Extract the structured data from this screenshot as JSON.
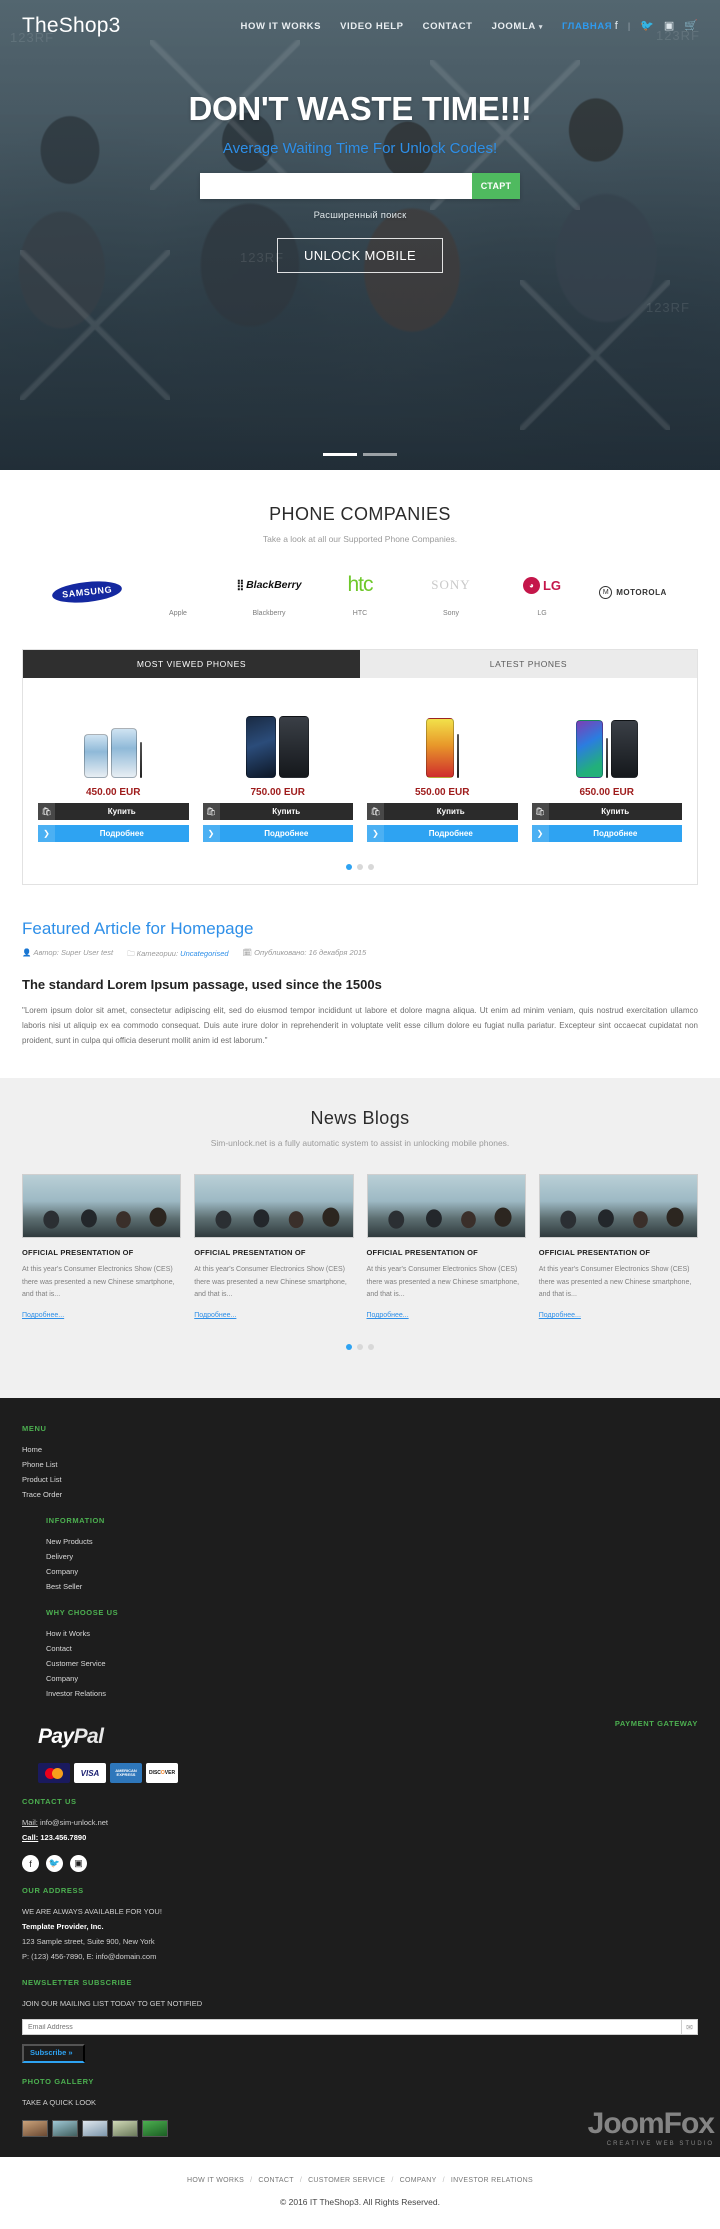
{
  "header": {
    "brand": "TheShop3",
    "nav": [
      {
        "label": "HOW IT WORKS",
        "active": false
      },
      {
        "label": "VIDEO HELP",
        "active": false
      },
      {
        "label": "CONTACT",
        "active": false
      },
      {
        "label": "JOOMLA",
        "active": false,
        "caret": "▾"
      },
      {
        "label": "ГЛАВНАЯ",
        "active": true
      }
    ],
    "social": [
      "f",
      "|",
      "twitter",
      "instagram",
      "cart"
    ]
  },
  "hero": {
    "title": "DON'T WASTE TIME!!!",
    "subtitle": "Average Waiting Time For Unlock Codes!",
    "search_placeholder": "",
    "search_value": "",
    "search_button": "СТАРТ",
    "advanced_search": "Расширенный поиск",
    "cta": "UNLOCK MOBILE",
    "slides": 3,
    "active_slide": 1
  },
  "companies": {
    "title": "PHONE COMPANIES",
    "subtitle": "Take a look at all our Supported Phone Companies.",
    "items": [
      {
        "name": "SAMSUNG",
        "caption": ""
      },
      {
        "name": "Apple",
        "caption": "Apple"
      },
      {
        "name": "BlackBerry",
        "caption": "Blackberry"
      },
      {
        "name": "htc",
        "caption": "HTC"
      },
      {
        "name": "SONY",
        "caption": "Sony"
      },
      {
        "name": "LG",
        "caption": "LG"
      },
      {
        "name": "MOTOROLA",
        "caption": ""
      }
    ]
  },
  "products": {
    "tabs": [
      {
        "label": "MOST VIEWED PHONES",
        "active": true
      },
      {
        "label": "LATEST PHONES",
        "active": false
      }
    ],
    "buy_label": "Купить",
    "more_label": "Подробнее",
    "cards": [
      {
        "price": "450.00 EUR"
      },
      {
        "price": "750.00 EUR"
      },
      {
        "price": "550.00 EUR"
      },
      {
        "price": "650.00 EUR"
      }
    ],
    "dots": 3,
    "active_dot": 1
  },
  "article": {
    "link_title": "Featured Article for Homepage",
    "author_label": "Автор:",
    "author": "Super User test",
    "category_label": "Категории:",
    "category": "Uncategorised",
    "published_label": "Опубликовано:",
    "published": "16 декабря 2015",
    "heading": "The standard Lorem Ipsum passage, used since the 1500s",
    "body": "\"Lorem ipsum dolor sit amet, consectetur adipiscing elit, sed do eiusmod tempor incididunt ut labore et dolore magna aliqua. Ut enim ad minim veniam, quis nostrud exercitation ullamco laboris nisi ut aliquip ex ea commodo consequat. Duis aute irure dolor in reprehenderit in voluptate velit esse cillum dolore eu fugiat nulla pariatur. Excepteur sint occaecat cupidatat non proident, sunt in culpa qui officia deserunt mollit anim id est laborum.\""
  },
  "news": {
    "title": "News Blogs",
    "subtitle": "Sim-unlock.net is a fully automatic system to assist in unlocking mobile phones.",
    "more_label": "Подробнее...",
    "cards": [
      {
        "title": "OFFICIAL PRESENTATION OF",
        "text": "At this year's Consumer Electronics Show (CES) there was presented a new Chinese smartphone, and that is..."
      },
      {
        "title": "OFFICIAL PRESENTATION OF",
        "text": "At this year's Consumer Electronics Show (CES) there was presented a new Chinese smartphone, and that is..."
      },
      {
        "title": "OFFICIAL PRESENTATION OF",
        "text": "At this year's Consumer Electronics Show (CES) there was presented a new Chinese smartphone, and that is..."
      },
      {
        "title": "OFFICIAL PRESENTATION OF",
        "text": "At this year's Consumer Electronics Show (CES) there was presented a new Chinese smartphone, and that is..."
      }
    ],
    "dots": 3,
    "active_dot": 1
  },
  "footer": {
    "menu_head": "MENU",
    "menu": [
      "Home",
      "Phone List",
      "Product List",
      "Trace Order"
    ],
    "information_head": "INFORMATION",
    "information": [
      "New Products",
      "Delivery",
      "Company",
      "Best Seller"
    ],
    "why_head": "WHY CHOOSE US",
    "why": [
      "How it Works",
      "Contact",
      "Customer Service",
      "Company",
      "Investor Relations"
    ],
    "payment_head": "PAYMENT GATEWAY",
    "paypal": "PayPal",
    "cards": [
      "MasterCard",
      "VISA",
      "AMERICAN EXPRESS",
      "DISCOVER"
    ],
    "contact_head": "CONTACT US",
    "mail_label": "Mail:",
    "mail": "info@sim-unlock.net",
    "call_label": "Call:",
    "call": "123.456.7890",
    "address_head": "OUR ADDRESS",
    "address_tagline": "WE ARE ALWAYS AVAILABLE FOR YOU!",
    "company": "Template Provider, Inc.",
    "street": "123 Sample street, Suite 900, New York",
    "phone_email": "P: (123) 456-7890, E: info@domain.com",
    "newsletter_head": "NEWSLETTER SUBSCRIBE",
    "newsletter_tagline": "JOIN OUR MAILING LIST TODAY TO GET NOTIFIED",
    "email_placeholder": "Email Address",
    "subscribe": "Subscribe »",
    "gallery_head": "PHOTO GALLERY",
    "gallery_tagline": "TAKE A QUICK LOOK",
    "watermark_big": "JoomFox",
    "watermark_small": "CREATIVE WEB STUDIO"
  },
  "bottom": {
    "links": [
      "HOW IT WORKS",
      "CONTACT",
      "CUSTOMER SERVICE",
      "COMPANY",
      "INVESTOR RELATIONS"
    ],
    "copyright": "© 2016 IT TheShop3. All Rights Reserved."
  }
}
